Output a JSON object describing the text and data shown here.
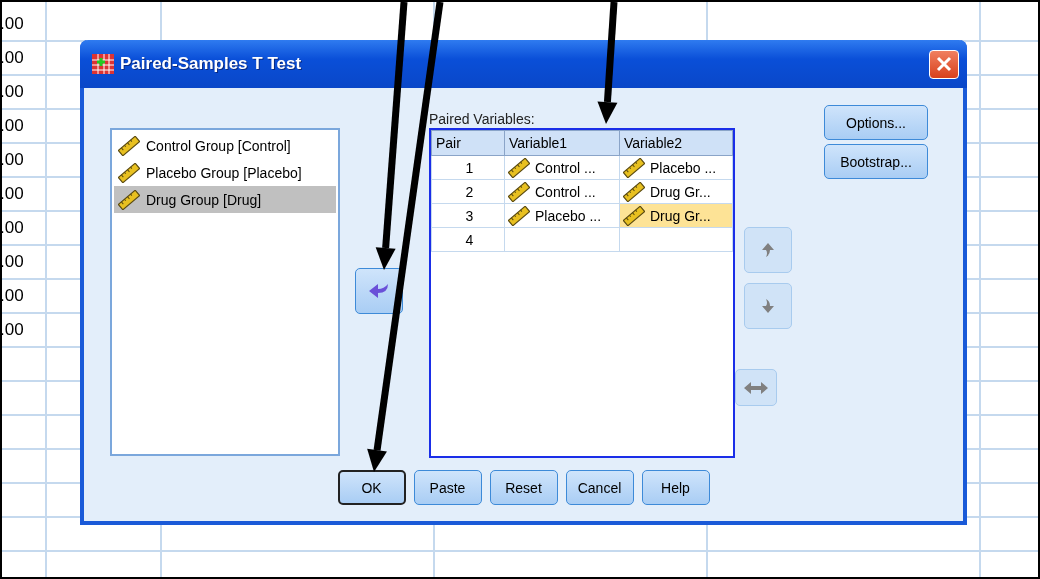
{
  "sheet": {
    "cells": [
      ".00",
      ".00",
      ".00",
      ".00",
      ".00",
      ".00",
      ".00",
      ".00",
      ".00",
      ".00"
    ]
  },
  "dialog": {
    "title": "Paired-Samples T Test",
    "source_list": [
      {
        "label": "Control Group [Control]",
        "selected": false
      },
      {
        "label": "Placebo Group [Placebo]",
        "selected": false
      },
      {
        "label": "Drug Group [Drug]",
        "selected": true
      }
    ],
    "move_button": {
      "disabled": false
    },
    "paired_variables": {
      "label": "Paired Variables:",
      "columns": [
        "Pair",
        "Variable1",
        "Variable2"
      ],
      "rows": [
        {
          "pair": "1",
          "variable1": {
            "text": "Control ...",
            "selected": false
          },
          "variable2": {
            "text": "Placebo ...",
            "selected": false
          }
        },
        {
          "pair": "2",
          "variable1": {
            "text": "Control ...",
            "selected": false
          },
          "variable2": {
            "text": "Drug Gr...",
            "selected": false
          }
        },
        {
          "pair": "3",
          "variable1": {
            "text": "Placebo ...",
            "selected": false
          },
          "variable2": {
            "text": "Drug Gr...",
            "selected": true
          }
        },
        {
          "pair": "4"
        }
      ]
    },
    "side_buttons": [
      {
        "label": "Options..."
      },
      {
        "label": "Bootstrap..."
      }
    ],
    "order_buttons": [
      {
        "kind": "up",
        "disabled": true
      },
      {
        "kind": "down",
        "disabled": true
      },
      {
        "kind": "swap",
        "disabled": true
      }
    ],
    "buttons": [
      {
        "label": "OK",
        "default": true
      },
      {
        "label": "Paste",
        "default": false
      },
      {
        "label": "Reset",
        "default": false
      },
      {
        "label": "Cancel",
        "default": false
      },
      {
        "label": "Help",
        "default": false
      }
    ]
  }
}
